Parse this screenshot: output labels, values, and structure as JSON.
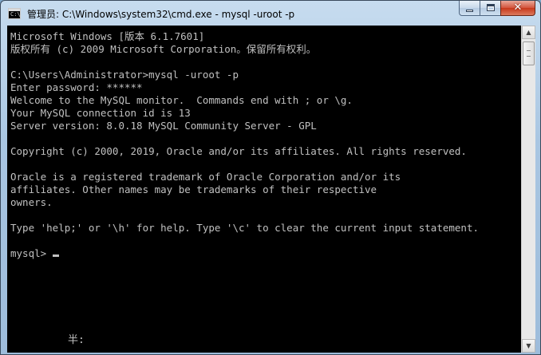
{
  "window": {
    "title": "管理员: C:\\Windows\\system32\\cmd.exe - mysql  -uroot -p",
    "icon": "cmd-console-icon",
    "icon_glyph": "C:\\",
    "buttons": {
      "minimize": "minimize-icon",
      "maximize": "maximize-icon",
      "close_glyph": "✕"
    }
  },
  "console": {
    "background": "#000000",
    "foreground": "#c0c0c0",
    "lines": [
      "Microsoft Windows [版本 6.1.7601]",
      "版权所有 (c) 2009 Microsoft Corporation。保留所有权利。",
      "",
      "C:\\Users\\Administrator>mysql -uroot -p",
      "Enter password: ******",
      "Welcome to the MySQL monitor.  Commands end with ; or \\g.",
      "Your MySQL connection id is 13",
      "Server version: 8.0.18 MySQL Community Server - GPL",
      "",
      "Copyright (c) 2000, 2019, Oracle and/or its affiliates. All rights reserved.",
      "",
      "Oracle is a registered trademark of Oracle Corporation and/or its",
      "affiliates. Other names may be trademarks of their respective",
      "owners.",
      "",
      "Type 'help;' or '\\h' for help. Type '\\c' to clear the current input statement.",
      ""
    ],
    "prompt": "mysql> ",
    "ime_status": "半:"
  },
  "scrollbar": {
    "up_glyph": "▲",
    "down_glyph": "▼"
  }
}
